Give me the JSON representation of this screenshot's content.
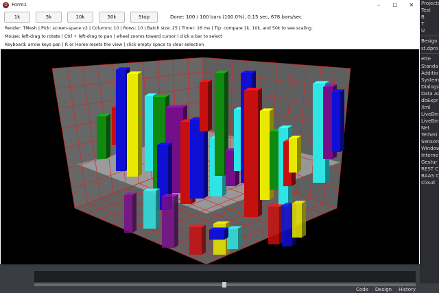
{
  "window": {
    "title": "Form1",
    "minimize": "–",
    "maximize": "☐",
    "close": "✕"
  },
  "toolbar": {
    "buttons": [
      "1k",
      "5k",
      "10k",
      "50k",
      "Stop"
    ],
    "status": "Done: 100 / 100 bars (100.0%), 0.15 sec, 678 bars/sec"
  },
  "info": {
    "render": "Render: TMesh | Pick: screen-space v2 | Columns: 10 | Rows: 10 | Batch size: 25 | Timer: 16 ms | Tip: compare 1k, 10k, and 50k to see scaling.",
    "mouse": "Mouse: left-drag to rotate | Ctrl + left-drag to pan | wheel zooms toward cursor | click a bar to select",
    "keyboard": "Keyboard: arrow keys pan | R or Home resets the view | click empty space to clear selection"
  },
  "ide": {
    "right_header": "Projects",
    "right_items": [
      "Test",
      "B",
      "T",
      "U"
    ],
    "section1": "Besign",
    "section1_items": [
      "st.dpro"
    ],
    "section2": "ette",
    "palette": [
      "Standa",
      "Additio",
      "System",
      "Dialogs",
      "Data Ac",
      "dbExpr",
      "Xml",
      "LiveBin",
      "LiveBin",
      "Net",
      "Tetheri",
      "Sensors",
      "Window",
      "Interne",
      "Gestur",
      "REST C",
      "BAAS C",
      "Cloud"
    ],
    "bottom_tabs": [
      "Code",
      "Design",
      "History"
    ]
  },
  "colors": {
    "blue": "#1010e0",
    "yellow": "#f5f500",
    "red": "#d01010",
    "green": "#109010",
    "cyan": "#30f0f0",
    "purple": "#7a1090",
    "grid": "#e02020"
  }
}
